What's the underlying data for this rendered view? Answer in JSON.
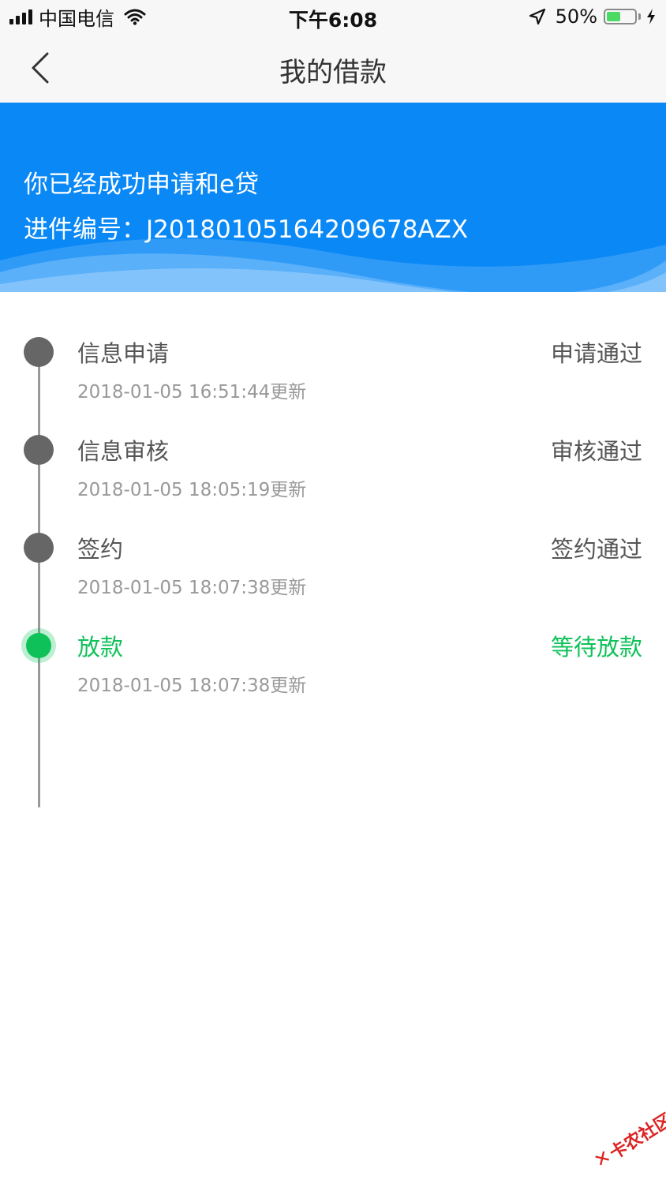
{
  "status_bar": {
    "carrier": "中国电信",
    "time": "下午6:08",
    "battery_percent": "50%",
    "battery_level": 0.5,
    "icons": [
      "signal-icon",
      "wifi-icon",
      "location-icon",
      "battery-icon",
      "charging-icon"
    ]
  },
  "nav": {
    "title": "我的借款",
    "back_icon": "chevron-left-icon"
  },
  "banner": {
    "message": "你已经成功申请和e贷",
    "ref_label": "进件编号：",
    "ref_value": "J20180105164209678AZX"
  },
  "timeline": {
    "steps": [
      {
        "title": "信息申请",
        "time": "2018-01-05 16:51:44更新",
        "status": "申请通过",
        "active": false
      },
      {
        "title": "信息审核",
        "time": "2018-01-05 18:05:19更新",
        "status": "审核通过",
        "active": false
      },
      {
        "title": "签约",
        "time": "2018-01-05 18:07:38更新",
        "status": "签约通过",
        "active": false
      },
      {
        "title": "放款",
        "time": "2018-01-05 18:07:38更新",
        "status": "等待放款",
        "active": true
      }
    ]
  },
  "watermark": {
    "text": "卡农社区"
  },
  "colors": {
    "banner_blue": "#0a88f5",
    "active_green": "#0ec158",
    "inactive_dot": "#666666",
    "battery_green": "#4cd964",
    "watermark_red": "#dd2222"
  }
}
